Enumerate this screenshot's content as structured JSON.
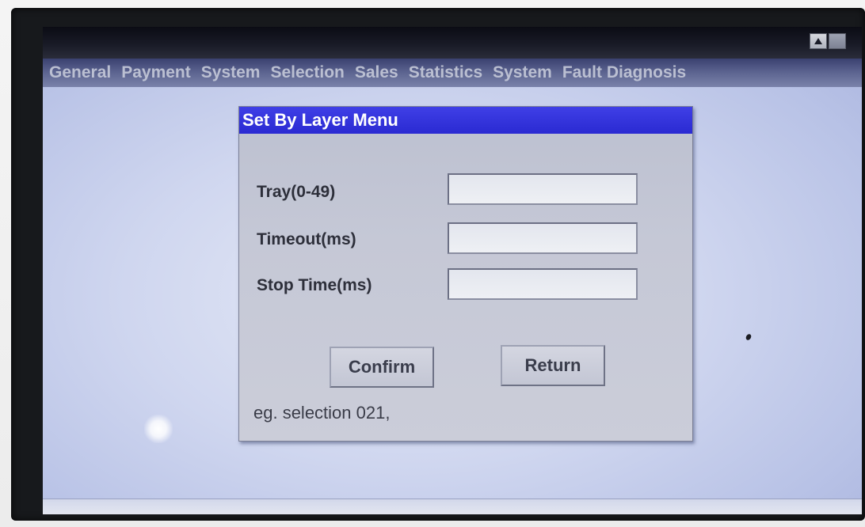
{
  "window": {
    "buttons": [
      {
        "icon": "scroll-up-icon"
      },
      {
        "icon": "window-box-icon"
      }
    ]
  },
  "menu": {
    "items": [
      "General",
      "Payment",
      "System",
      "Selection",
      "Sales",
      "Statistics",
      "System",
      "Fault Diagnosis"
    ]
  },
  "dialog": {
    "title": "Set By Layer Menu",
    "fields": [
      {
        "label": "Tray(0-49)",
        "value": ""
      },
      {
        "label": "Timeout(ms)",
        "value": ""
      },
      {
        "label": "Stop Time(ms)",
        "value": ""
      }
    ],
    "confirm_label": "Confirm",
    "return_label": "Return",
    "hint": "eg. selection 021,"
  },
  "colors": {
    "dialog_title_bar": "#2a2ad2",
    "screen_background": "#cfd6ef",
    "menu_bar": "#5a628e"
  }
}
